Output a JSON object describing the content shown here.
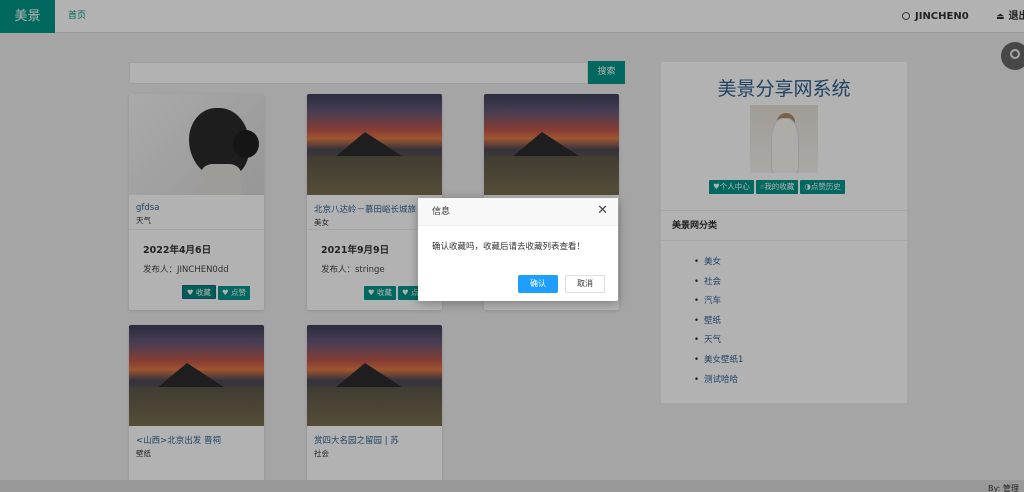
{
  "header": {
    "brand": "美景",
    "nav_home": "首页",
    "username": "JINCHEN0",
    "logout": "退出"
  },
  "search": {
    "button_label": "搜索",
    "value": ""
  },
  "cards": [
    {
      "title": "gfdsa",
      "category": "天气",
      "date": "2022年4月6日",
      "author": "发布人：JINCHEN0dd",
      "collect": "收藏",
      "like": "点赞",
      "image": "portrait"
    },
    {
      "title": "北京八达岭－慕田峪长城旅",
      "category": "美女",
      "date": "2021年9月9日",
      "author": "发布人：stringe",
      "collect": "收藏",
      "like": "点赞",
      "image": "landscape"
    },
    {
      "title": "",
      "category": "",
      "date": "",
      "author": "",
      "collect": "",
      "like": "",
      "image": "landscape"
    },
    {
      "title": "<山西>北京出发 晋祠",
      "category": "壁纸",
      "image": "landscape"
    },
    {
      "title": "赏四大名园之留园 | 苏",
      "category": "社会",
      "image": "landscape"
    }
  ],
  "sidebar": {
    "title": "美景分享网系统",
    "actions": [
      "个人中心",
      "我的收藏",
      "点赞历史"
    ],
    "category_heading": "美景网分类",
    "categories": [
      "美女",
      "社会",
      "汽车",
      "壁纸",
      "天气",
      "美女壁纸1",
      "测试哈哈"
    ]
  },
  "dialog": {
    "title": "信息",
    "message": "确认收藏吗，收藏后请去收藏列表查看！",
    "confirm": "确认",
    "cancel": "取消"
  },
  "footer": {
    "text": "By: 管理"
  },
  "colors": {
    "brand": "#009688",
    "link": "#2f5f8f",
    "confirm": "#1e9fff"
  }
}
